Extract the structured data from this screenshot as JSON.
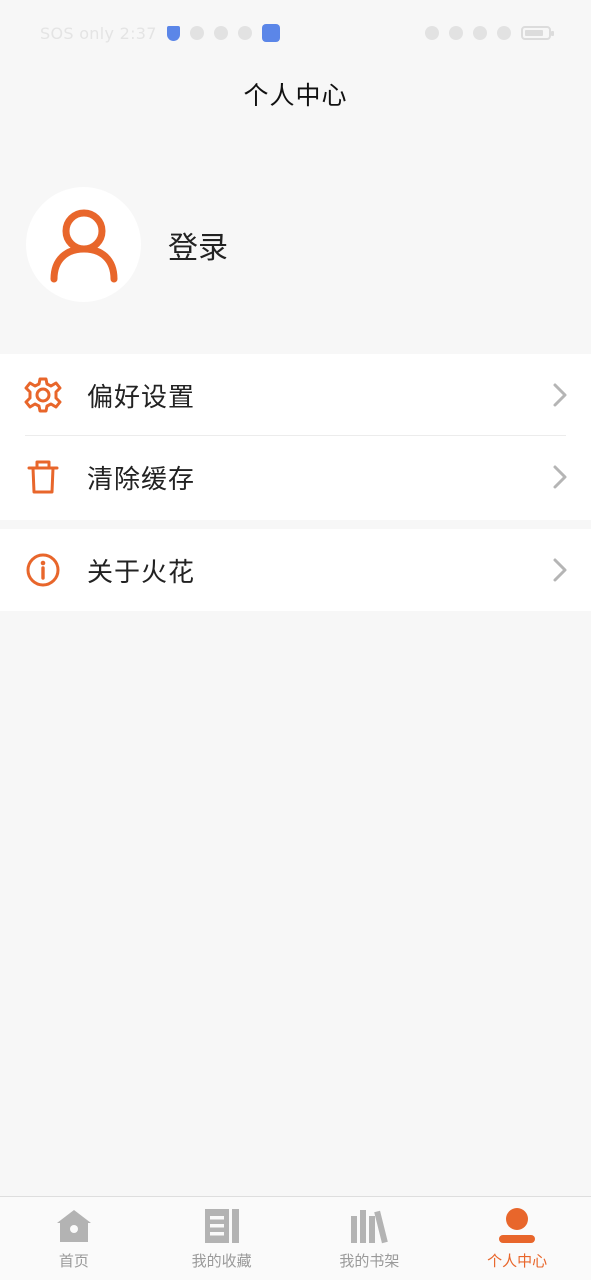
{
  "status_bar": {
    "left_text": "SOS only 2:37",
    "icons": [
      "shield-icon",
      "bell-icon",
      "vpn-icon",
      "download-icon",
      "app-badge-icon"
    ],
    "right_icons": [
      "nfc-icon",
      "vibrate-icon",
      "wifi-icon",
      "sim-icon",
      "battery-icon"
    ]
  },
  "header": {
    "title": "个人中心"
  },
  "profile": {
    "login_label": "登录",
    "avatar_icon": "user-icon"
  },
  "menu": {
    "preferences": {
      "label": "偏好设置",
      "icon": "gear-icon"
    },
    "clear_cache": {
      "label": "清除缓存",
      "icon": "trash-icon"
    },
    "about": {
      "label": "关于火花",
      "icon": "info-icon"
    }
  },
  "tabbar": {
    "tabs": [
      {
        "label": "首页",
        "icon": "home-icon",
        "active": false
      },
      {
        "label": "我的收藏",
        "icon": "bookmark-icon",
        "active": false
      },
      {
        "label": "我的书架",
        "icon": "bookshelf-icon",
        "active": false
      },
      {
        "label": "个人中心",
        "icon": "profile-icon",
        "active": true
      }
    ]
  },
  "colors": {
    "accent": "#e8662b",
    "inactive": "#9a9a9a",
    "background": "#f7f7f7"
  }
}
